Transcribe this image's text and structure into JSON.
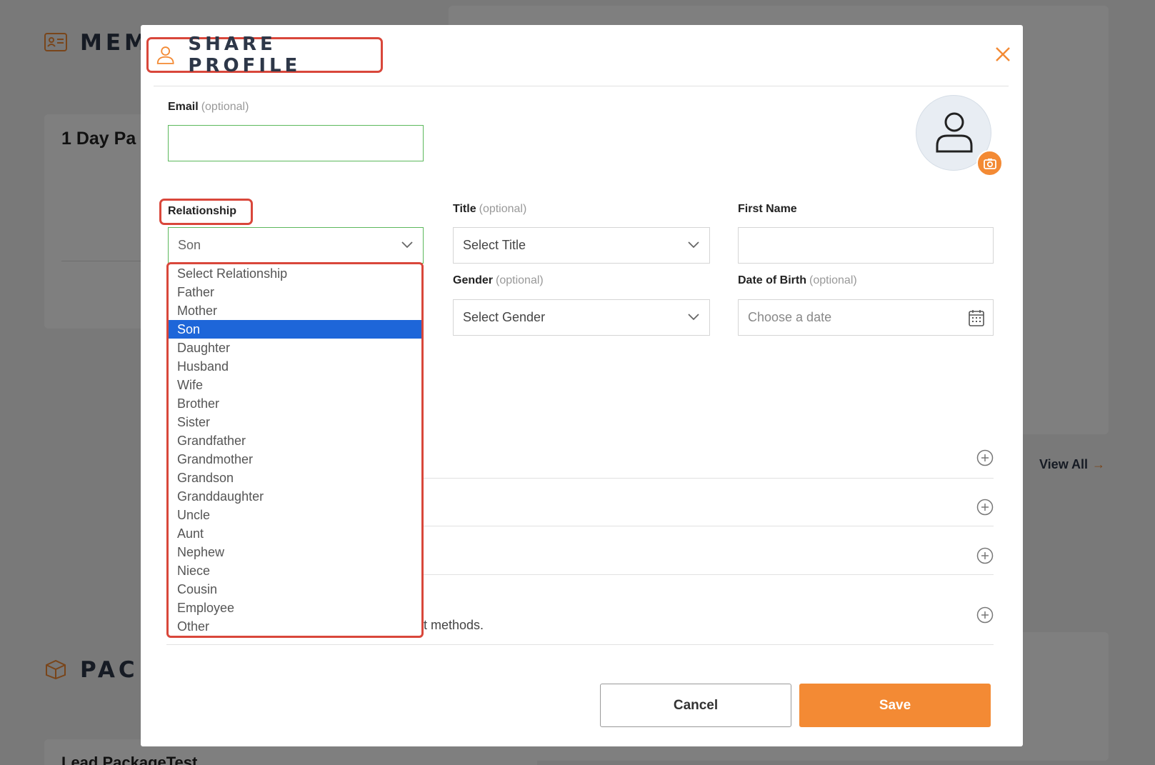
{
  "background": {
    "heading_top": "MEM",
    "heading_bottom": "PAC",
    "card_title": "1 Day Pa",
    "card_bottom_title": "Lead PackageTest",
    "view_all": "View All"
  },
  "modal": {
    "title": "SHARE PROFILE",
    "close_icon": "close-icon",
    "email": {
      "label": "Email",
      "optional": "(optional)",
      "value": ""
    },
    "relationship": {
      "label": "Relationship",
      "value": "Son"
    },
    "title_field": {
      "label": "Title",
      "optional": "(optional)",
      "value": "Select Title"
    },
    "first_name": {
      "label": "First Name",
      "value": ""
    },
    "gender": {
      "label": "Gender",
      "optional": "(optional)",
      "value": "Select Gender"
    },
    "dob": {
      "label": "Date of Birth",
      "optional": "(optional)",
      "placeholder": "Choose a date"
    },
    "dropdown_options": [
      "Select Relationship",
      "Father",
      "Mother",
      "Son",
      "Daughter",
      "Husband",
      "Wife",
      "Brother",
      "Sister",
      "Grandfather",
      "Grandmother",
      "Grandson",
      "Granddaughter",
      "Uncle",
      "Aunt",
      "Nephew",
      "Niece",
      "Cousin",
      "Employee",
      "Other"
    ],
    "selected_option": "Son",
    "methods_text": "t methods.",
    "cancel_label": "Cancel",
    "save_label": "Save"
  },
  "colors": {
    "accent": "#f38a34",
    "highlight_border": "#d9473b",
    "selected_option_bg": "#1e66d9",
    "valid_input_border": "#5cb85c"
  }
}
